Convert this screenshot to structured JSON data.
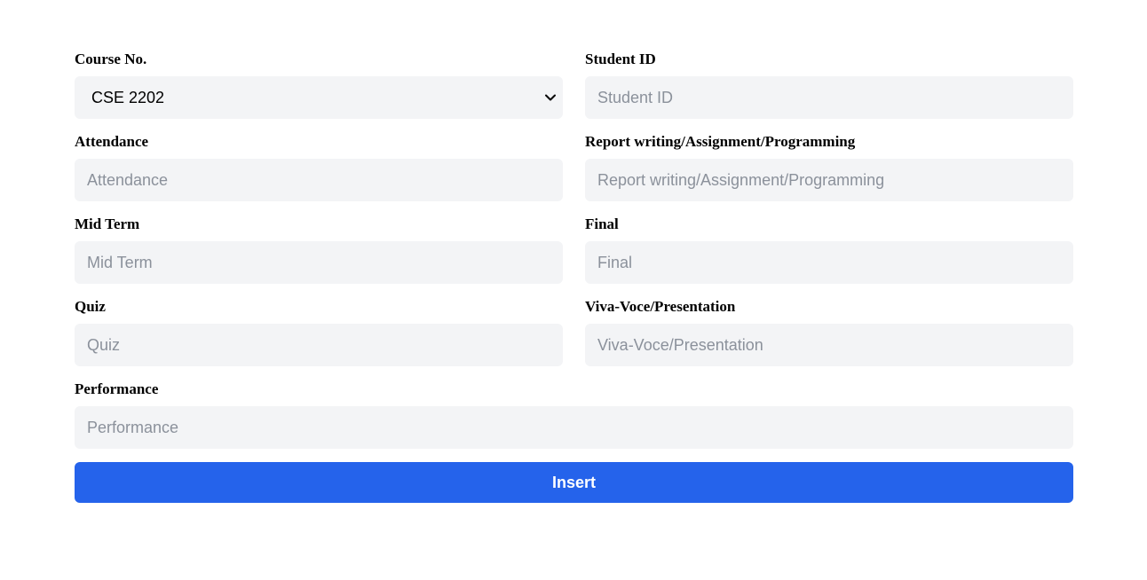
{
  "form": {
    "course": {
      "label": "Course No.",
      "selected": "CSE 2202"
    },
    "student_id": {
      "label": "Student ID",
      "placeholder": "Student ID"
    },
    "attendance": {
      "label": "Attendance",
      "placeholder": "Attendance"
    },
    "report": {
      "label": "Report writing/Assignment/Programming",
      "placeholder": "Report writing/Assignment/Programming"
    },
    "mid_term": {
      "label": "Mid Term",
      "placeholder": "Mid Term"
    },
    "final": {
      "label": "Final",
      "placeholder": "Final"
    },
    "quiz": {
      "label": "Quiz",
      "placeholder": "Quiz"
    },
    "viva": {
      "label": "Viva-Voce/Presentation",
      "placeholder": "Viva-Voce/Presentation"
    },
    "performance": {
      "label": "Performance",
      "placeholder": "Performance"
    },
    "submit_label": "Insert"
  },
  "colors": {
    "accent": "#2563eb",
    "field_bg": "#f3f4f6",
    "placeholder": "#8b919b"
  }
}
